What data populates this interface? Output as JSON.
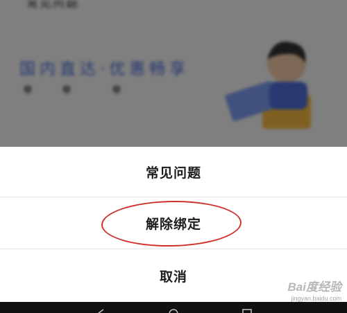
{
  "background_page": {
    "title": "常见问题",
    "heading": "国内直达·优惠畅享"
  },
  "action_sheet": {
    "items": [
      {
        "label": "常见问题"
      },
      {
        "label": "解除绑定",
        "highlighted": true
      }
    ],
    "cancel_label": "取消"
  },
  "annotation": {
    "color": "#d1302a"
  },
  "watermark": {
    "logo": "Bai度经验",
    "url": "jingyan.baidu.com"
  },
  "navbar_icons": [
    "back-icon",
    "home-icon",
    "recents-icon"
  ]
}
